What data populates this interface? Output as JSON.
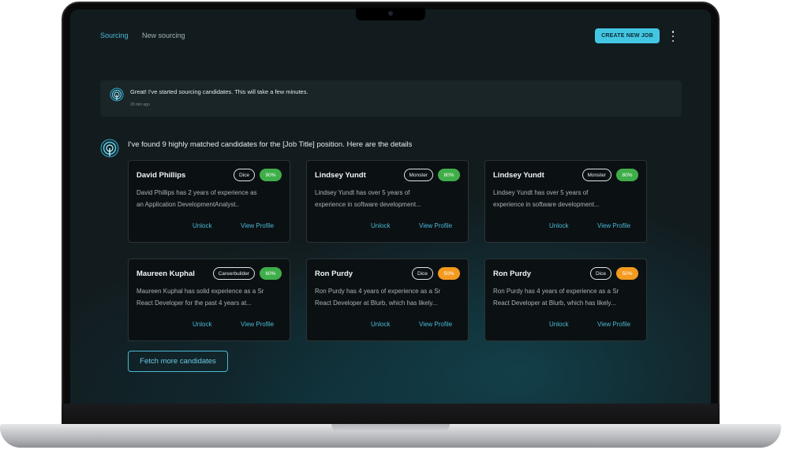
{
  "nav": {
    "sourcing": "Sourcing",
    "new_sourcing": "New sourcing",
    "create_button": "CREATE NEW JOB",
    "menu_icon": "kebab-menu-icon"
  },
  "messages": [
    {
      "text": "Great! I've started sourcing candidates. This will take a few minutes.",
      "time": "20 min ago"
    },
    {
      "text": "I've found 9 highly matched candidates for the [Job Title] position. Here are the details"
    }
  ],
  "cards": [
    {
      "name": "David Phillips",
      "source": "Dice",
      "match": "90%",
      "match_color": "#3fae49",
      "desc1": "David Phillips has 2 years of experience as",
      "desc2": "an Application DevelopmentAnalyst..",
      "unlock": "Unlock",
      "view": "View Profile"
    },
    {
      "name": "Lindsey Yundt",
      "source": "Monster",
      "match": "80%",
      "match_color": "#3fae49",
      "desc1": "Lindsey Yundt has over 5 years of",
      "desc2": "experience in software development...",
      "unlock": "Unlock",
      "view": "View Profile"
    },
    {
      "name": "Lindsey Yundt",
      "source": "Monster",
      "match": "80%",
      "match_color": "#3fae49",
      "desc1": "Lindsey Yundt has over 5 years of",
      "desc2": "experience in software development...",
      "unlock": "Unlock",
      "view": "View Profile"
    },
    {
      "name": "Maureen Kuphal",
      "source": "Careerbuilder",
      "match": "60%",
      "match_color": "#3fae49",
      "desc1": "Maureen Kuphal has solid experience as a Sr",
      "desc2": "React Developer for the past 4 years at...",
      "unlock": "Unlock",
      "view": "View Profile"
    },
    {
      "name": "Ron Purdy",
      "source": "Dice",
      "match": "50%",
      "match_color": "#f39a1f",
      "desc1": "Ron Purdy has 4 years of experience as a Sr",
      "desc2": "React Developer at Blurb, which has likely...",
      "unlock": "Unlock",
      "view": "View Profile"
    },
    {
      "name": "Ron Purdy",
      "source": "Dice",
      "match": "50%",
      "match_color": "#f39a1f",
      "desc1": "Ron Purdy has 4 years of experience as a Sr",
      "desc2": "React Developer at Blurb, which has likely...",
      "unlock": "Unlock",
      "view": "View Profile"
    }
  ],
  "fetch_button": "Fetch more candidates",
  "colors": {
    "accent": "#43c6e2",
    "link": "#4cb8d6",
    "high_match": "#3fae49",
    "mid_match": "#f39a1f"
  }
}
